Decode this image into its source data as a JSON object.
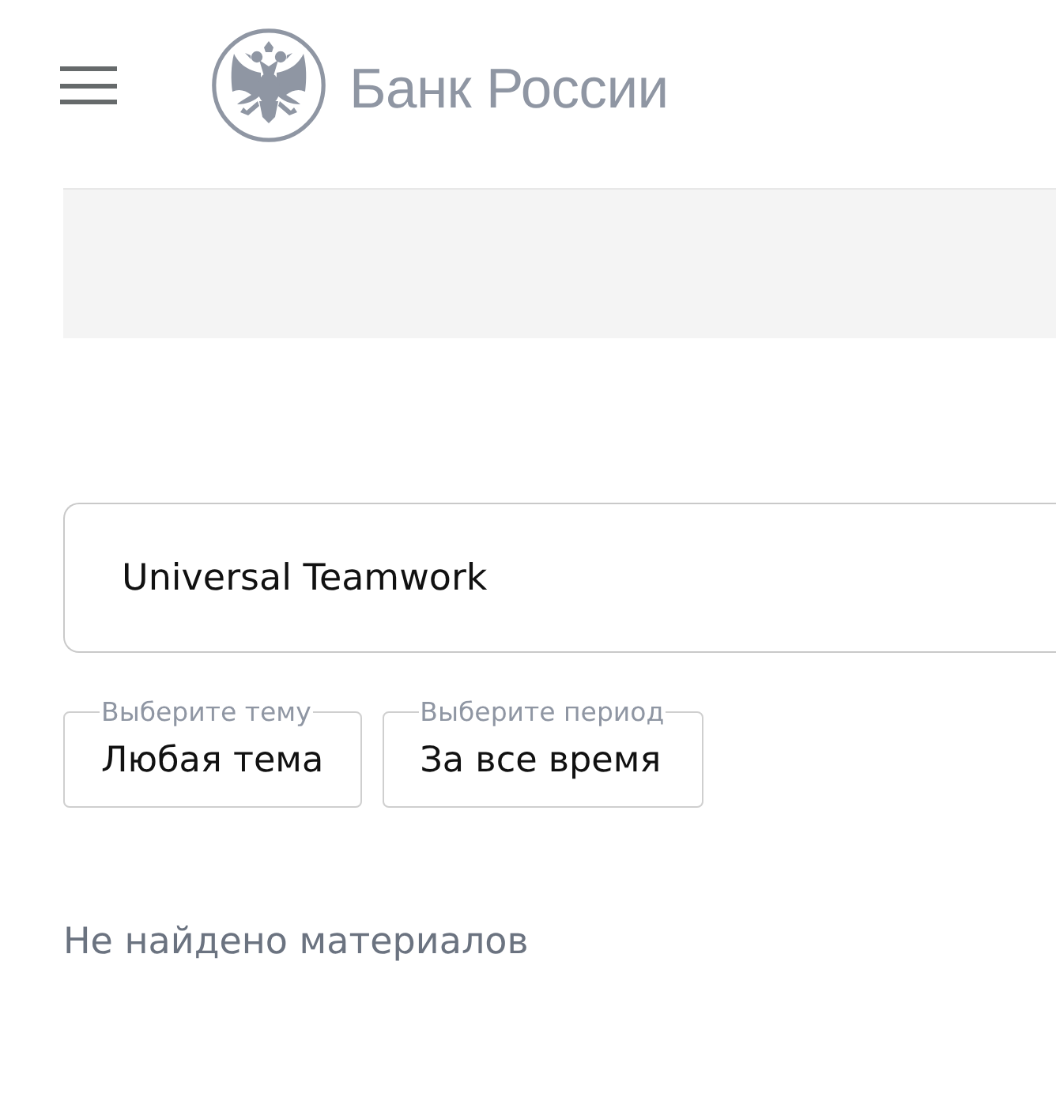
{
  "header": {
    "brand": "Банк России"
  },
  "search": {
    "value": "Universal Teamwork"
  },
  "filters": [
    {
      "label": "Выберите тему",
      "value": "Любая тема"
    },
    {
      "label": "Выберите период",
      "value": "За все время"
    }
  ],
  "empty_message": "Не найдено материалов"
}
